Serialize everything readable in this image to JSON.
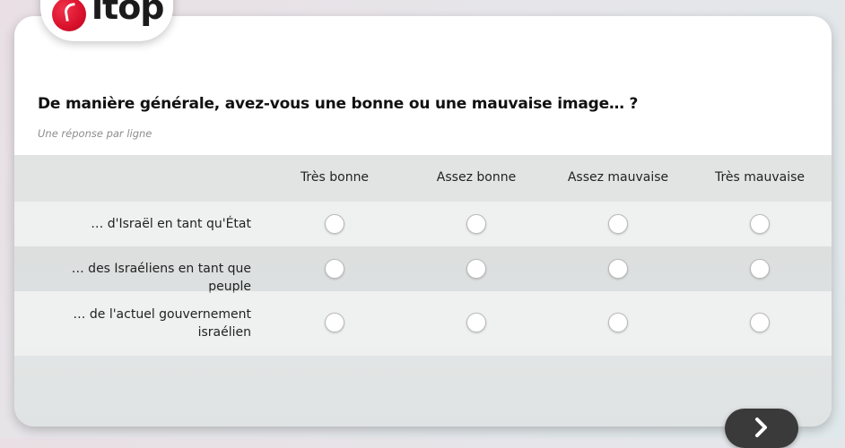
{
  "brand": {
    "logo_text": "itop"
  },
  "question": {
    "title": "De manière générale, avez-vous une bonne ou une mauvaise image… ?",
    "instruction": "Une réponse par ligne"
  },
  "columns": [
    "Très bonne",
    "Assez bonne",
    "Assez mauvaise",
    "Très mauvaise"
  ],
  "rows": [
    {
      "label": "… d'Israël en tant qu'État",
      "selected": null
    },
    {
      "label": "… des Israéliens en tant que peuple",
      "selected": null
    },
    {
      "label": "… de l'actuel gouvernement israélien",
      "selected": null
    }
  ],
  "navigation": {
    "next_icon": "chevron-right-icon"
  },
  "colors": {
    "brand_red": "#d8102b",
    "next_button": "#3a3a3a"
  }
}
